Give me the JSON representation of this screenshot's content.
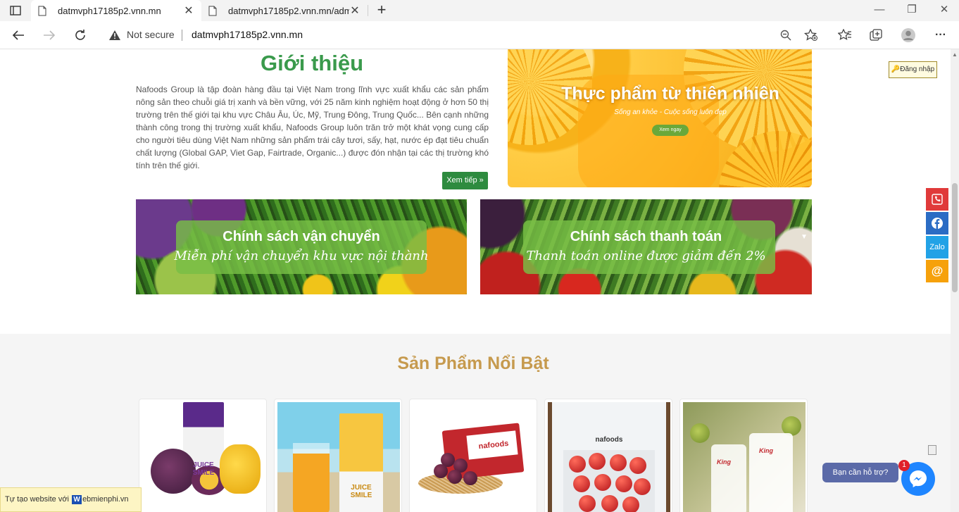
{
  "browser": {
    "tabs": [
      {
        "title": "datmvph17185p2.vnn.mn",
        "active": true
      },
      {
        "title": "datmvph17185p2.vnn.mn/admin",
        "active": false
      }
    ],
    "security_label": "Not secure",
    "url": "datmvph17185p2.vnn.mn",
    "close_glyph": "✕",
    "new_tab_glyph": "+",
    "window_controls": {
      "minimize": "—",
      "restore": "❐",
      "close": "✕"
    },
    "more_glyph": "···"
  },
  "intro": {
    "title": "Giới thiệu",
    "body": "Nafoods Group là tập đoàn hàng đầu tại Việt Nam trong lĩnh vực xuất khẩu các sản phẩm nông sản theo chuỗi giá trị xanh và bền vững, với 25 năm kinh nghiệm hoạt động ở hơn 50 thị trường trên thế giới tại khu vực Châu Âu, Úc, Mỹ, Trung Đông, Trung Quốc... Bên cạnh những thành công trong thị trường xuất khẩu, Nafoods Group luôn trăn trở một khát vọng cung cấp cho người tiêu dùng Việt Nam những sản phẩm trái cây tươi, sấy, hạt, nước ép đạt tiêu chuẩn chất lượng (Global GAP, Viet Gap, Fairtrade, Organic...) được đón nhận tại các thị trường khó tính trên thế giới.",
    "more_button": "Xem tiếp »"
  },
  "hero": {
    "title": "Thực phẩm từ thiên nhiên",
    "subtitle": "Sống an khỏe - Cuộc sống luôn đẹp",
    "button": "Xem ngay"
  },
  "banners": [
    {
      "title": "Chính sách vận chuyển",
      "subtitle": "Miễn phí vận chuyển khu vực nội thành"
    },
    {
      "title": "Chính sách thanh toán",
      "subtitle": "Thanh toán online được giảm đến 2%"
    }
  ],
  "featured": {
    "title": "Sản Phẩm Nổi Bật",
    "products": [
      {
        "label": "JUICE SMILE"
      },
      {
        "label": "JUICE SMILE"
      },
      {
        "label": "nafoods"
      },
      {
        "label": "nafoods"
      },
      {
        "label": "King"
      }
    ]
  },
  "widgets": {
    "login": "Đăng nhập",
    "zalo": "Zalo",
    "mail": "@",
    "help": "Bạn cần hỗ trợ?",
    "badge": "1",
    "promo_prefix": "Tự tạo website với ",
    "promo_w": "W",
    "promo_suffix": "ebmienphi.vn"
  },
  "colors": {
    "accent_green": "#3a9a4c",
    "featured_gold": "#c69a4e",
    "button_green": "#2e8b3f"
  }
}
